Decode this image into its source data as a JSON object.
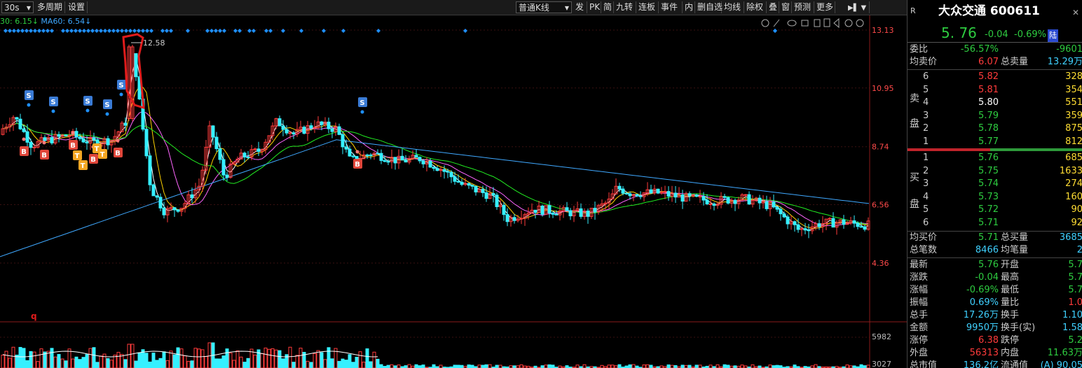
{
  "toolbar": {
    "period": "30s",
    "multi_period": "多周期",
    "settings": "设置",
    "kline_type": "普通K线",
    "buttons": [
      "发",
      "PK",
      "简",
      "九转",
      "连板",
      "事件",
      "内",
      "删自选",
      "均线",
      "除权",
      "叠",
      "窗",
      "预测",
      "更多"
    ]
  },
  "ma_legend": {
    "ma30": "30: 6.15↓",
    "ma60": "MA60: 6.54↓"
  },
  "price_axis": [
    "13.13",
    "10.95",
    "8.74",
    "6.56",
    "4.36"
  ],
  "volume_axis": [
    "5982",
    "3027"
  ],
  "annotations": {
    "high_label": "12.58",
    "signal_s": "S",
    "signal_b": "B",
    "signal_t": "T",
    "q_mark": "q"
  },
  "colors": {
    "up": "#ff3b3b",
    "down": "#35f0ff",
    "ma5": "#ffffff",
    "ma10": "#ffd200",
    "ma20": "#ff66ff",
    "ma30": "#22ee22",
    "ma60": "#3fa8ff",
    "marker": "#1e90ff",
    "circle": "#ff7b7b"
  },
  "panel": {
    "r_mark": "R",
    "name": "大众交通 600611",
    "price": "5. 76",
    "change": "-0.04",
    "change_pct": "-0.69%",
    "tag": "陆",
    "weibi_label": "委比",
    "weibi_pct": "-56.57%",
    "weibi_val": "-9601",
    "avg_sell_label": "均卖价",
    "avg_sell": "6.07",
    "total_sell_label": "总卖量",
    "total_sell": "13.29万",
    "sell_side": "卖",
    "sell_side2": "盘",
    "sells": [
      {
        "lvl": "6",
        "price": "5.82",
        "vol": "328"
      },
      {
        "lvl": "5",
        "price": "5.81",
        "vol": "354"
      },
      {
        "lvl": "4",
        "price": "5.80",
        "vol": "551"
      },
      {
        "lvl": "3",
        "price": "5.79",
        "vol": "359"
      },
      {
        "lvl": "2",
        "price": "5.78",
        "vol": "875"
      },
      {
        "lvl": "1",
        "price": "5.77",
        "vol": "812"
      }
    ],
    "buy_side": "买",
    "buy_side2": "盘",
    "buys": [
      {
        "lvl": "1",
        "price": "5.76",
        "vol": "685"
      },
      {
        "lvl": "2",
        "price": "5.75",
        "vol": "1633"
      },
      {
        "lvl": "3",
        "price": "5.74",
        "vol": "274"
      },
      {
        "lvl": "4",
        "price": "5.73",
        "vol": "160"
      },
      {
        "lvl": "5",
        "price": "5.72",
        "vol": "90"
      },
      {
        "lvl": "6",
        "price": "5.71",
        "vol": "92"
      }
    ],
    "avg_buy_label": "均买价",
    "avg_buy": "5.71",
    "total_buy_label": "总买量",
    "total_buy": "3685",
    "total_trades_label": "总笔数",
    "total_trades": "8466",
    "avg_vol_label": "均笔量",
    "avg_vol": "2",
    "stats": [
      {
        "l1": "最新",
        "v1": "5.76",
        "c1": "green",
        "l2": "开盘",
        "v2": "5.7",
        "c2": "green"
      },
      {
        "l1": "涨跌",
        "v1": "-0.04",
        "c1": "green",
        "l2": "最高",
        "v2": "5.7",
        "c2": "green"
      },
      {
        "l1": "涨幅",
        "v1": "-0.69%",
        "c1": "green",
        "l2": "最低",
        "v2": "5.7",
        "c2": "green"
      },
      {
        "l1": "振幅",
        "v1": "0.69%",
        "c1": "cyan",
        "l2": "量比",
        "v2": "1.0",
        "c2": "red"
      },
      {
        "l1": "总手",
        "v1": "17.26万",
        "c1": "cyan",
        "l2": "换手",
        "v2": "1.10",
        "c2": "cyan"
      },
      {
        "l1": "金额",
        "v1": "9950万",
        "c1": "cyan",
        "l2": "换手(实)",
        "v2": "1.58",
        "c2": "cyan"
      },
      {
        "l1": "涨停",
        "v1": "6.38",
        "c1": "red",
        "l2": "跌停",
        "v2": "5.2",
        "c2": "green"
      },
      {
        "l1": "外盘",
        "v1": "56313",
        "c1": "red",
        "l2": "内盘",
        "v2": "11.63万",
        "c2": "green"
      },
      {
        "l1": "总市值",
        "v1": "136.2亿",
        "c1": "cyan",
        "l2": "流通值",
        "v2": "(A) 90.05",
        "c2": "cyan"
      }
    ]
  }
}
